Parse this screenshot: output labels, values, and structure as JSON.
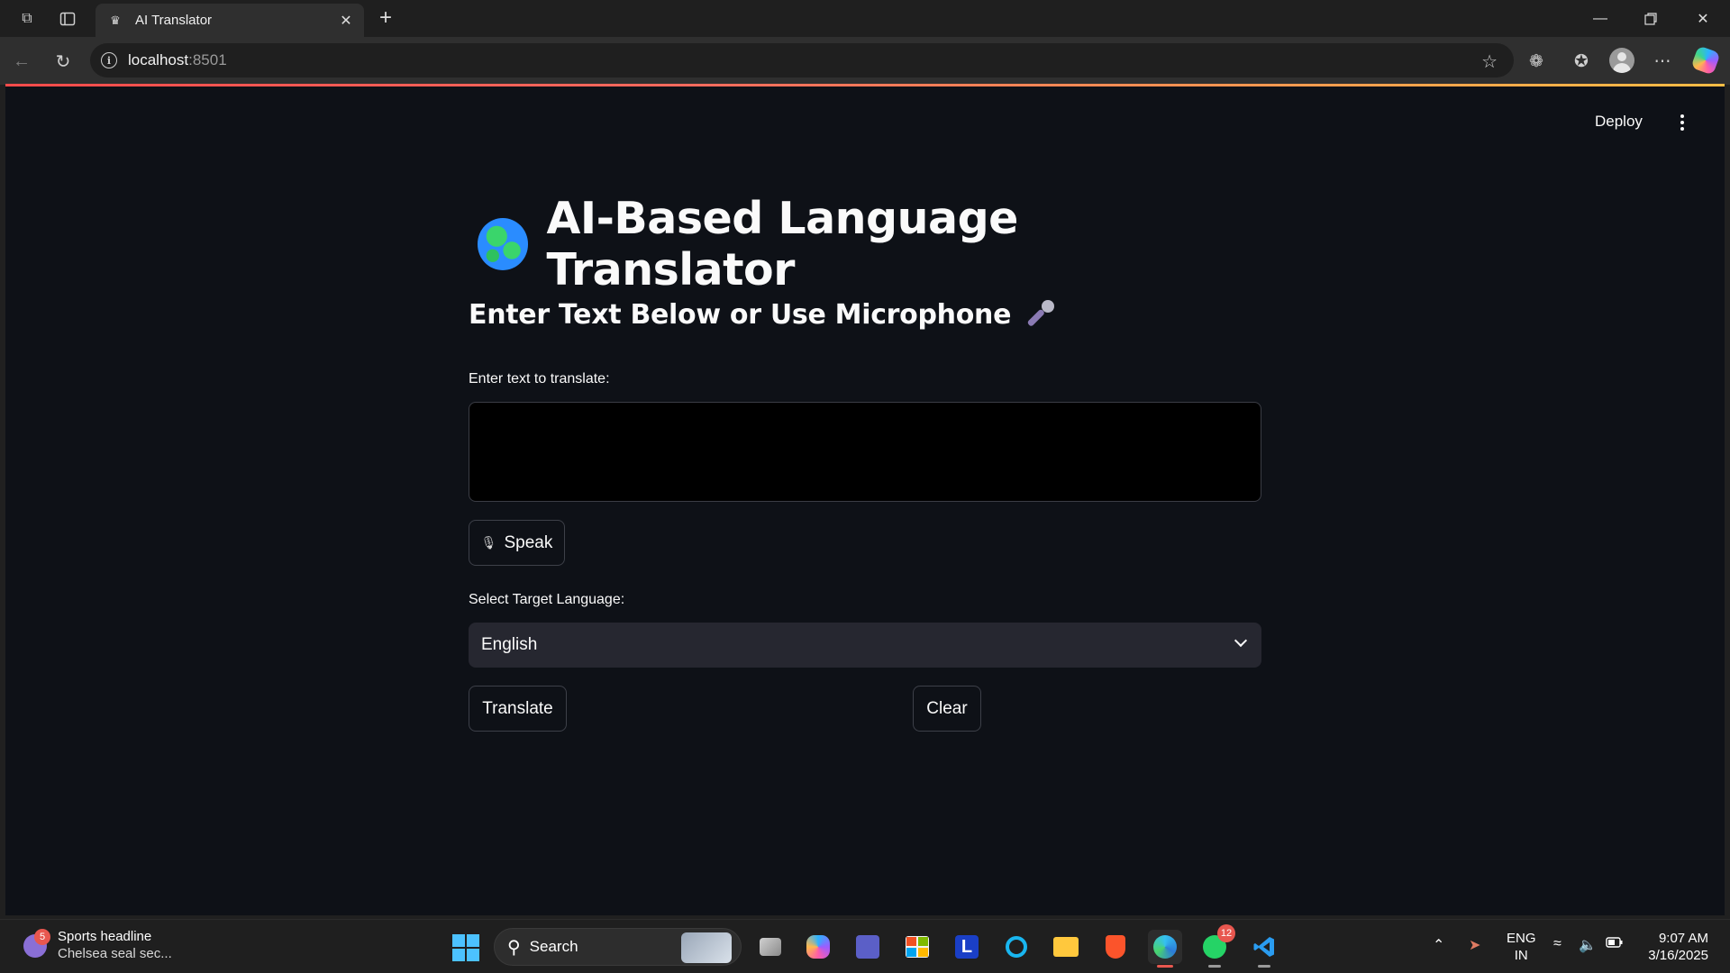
{
  "browser": {
    "tab_title": "AI Translator",
    "url_host": "localhost",
    "url_port": ":8501"
  },
  "app_header": {
    "deploy_label": "Deploy"
  },
  "main": {
    "title": "AI-Based Language Translator",
    "subheader": "Enter Text Below or Use Microphone",
    "text_label": "Enter text to translate:",
    "text_value": "",
    "speak_label": "Speak",
    "select_label": "Select Target Language:",
    "selected_language": "English",
    "translate_label": "Translate",
    "clear_label": "Clear"
  },
  "taskbar": {
    "news_badge": "5",
    "news_title": "Sports headline",
    "news_subtitle": "Chelsea seal sec...",
    "search_label": "Search",
    "whatsapp_badge": "12",
    "lang_line1": "ENG",
    "lang_line2": "IN",
    "time": "9:07 AM",
    "date": "3/16/2025"
  },
  "colors": {
    "page_bg": "#0e1117",
    "select_bg": "#262730",
    "accent_gradient_start": "#ff4b4b",
    "accent_gradient_end": "#ffbd45",
    "start_blue": "#4cc2ff"
  },
  "icons": [
    "workspaces-icon",
    "vertical-tabs-icon",
    "streamlit-favicon",
    "close-icon",
    "plus-icon",
    "minimize-icon",
    "restore-icon",
    "back-icon",
    "reload-icon",
    "info-icon",
    "star-icon",
    "extensions-icon",
    "favorites-icon",
    "profile-icon",
    "more-icon",
    "copilot-icon",
    "globe-icon",
    "microphone-icon",
    "chevron-down-icon",
    "windows-start-icon",
    "search-icon"
  ]
}
